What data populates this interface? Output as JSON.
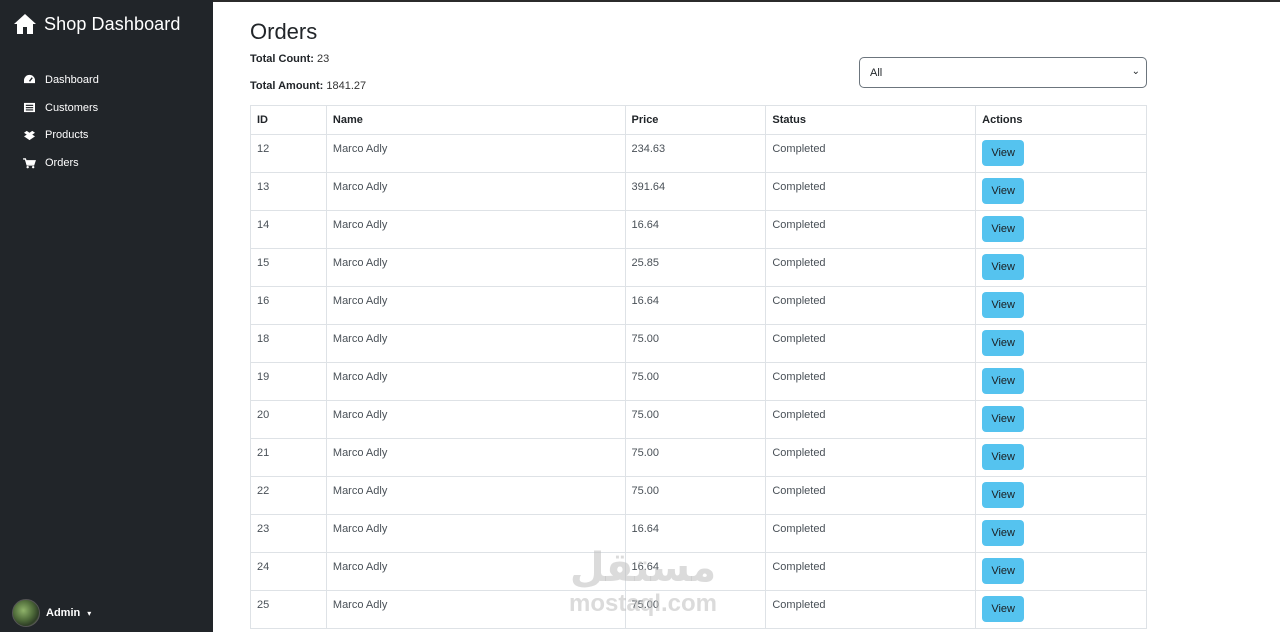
{
  "sidebar": {
    "brand": "Shop Dashboard",
    "items": [
      {
        "label": "Dashboard",
        "icon": "dashboard-icon"
      },
      {
        "label": "Customers",
        "icon": "list-icon"
      },
      {
        "label": "Products",
        "icon": "box-icon"
      },
      {
        "label": "Orders",
        "icon": "cart-icon"
      }
    ],
    "user": {
      "name": "Admin"
    }
  },
  "page": {
    "title": "Orders",
    "total_count_label": "Total Count:",
    "total_count": "23",
    "total_amount_label": "Total Amount:",
    "total_amount": "1841.27",
    "filter": {
      "selected": "All"
    }
  },
  "table": {
    "columns": [
      "ID",
      "Name",
      "Price",
      "Status",
      "Actions"
    ],
    "action_label": "View",
    "rows": [
      {
        "id": "12",
        "name": "Marco Adly",
        "price": "234.63",
        "status": "Completed"
      },
      {
        "id": "13",
        "name": "Marco Adly",
        "price": "391.64",
        "status": "Completed"
      },
      {
        "id": "14",
        "name": "Marco Adly",
        "price": "16.64",
        "status": "Completed"
      },
      {
        "id": "15",
        "name": "Marco Adly",
        "price": "25.85",
        "status": "Completed"
      },
      {
        "id": "16",
        "name": "Marco Adly",
        "price": "16.64",
        "status": "Completed"
      },
      {
        "id": "18",
        "name": "Marco Adly",
        "price": "75.00",
        "status": "Completed"
      },
      {
        "id": "19",
        "name": "Marco Adly",
        "price": "75.00",
        "status": "Completed"
      },
      {
        "id": "20",
        "name": "Marco Adly",
        "price": "75.00",
        "status": "Completed"
      },
      {
        "id": "21",
        "name": "Marco Adly",
        "price": "75.00",
        "status": "Completed"
      },
      {
        "id": "22",
        "name": "Marco Adly",
        "price": "75.00",
        "status": "Completed"
      },
      {
        "id": "23",
        "name": "Marco Adly",
        "price": "16.64",
        "status": "Completed"
      },
      {
        "id": "24",
        "name": "Marco Adly",
        "price": "16.64",
        "status": "Completed"
      },
      {
        "id": "25",
        "name": "Marco Adly",
        "price": "75.00",
        "status": "Completed"
      }
    ]
  },
  "watermark": {
    "arabic": "مستقل",
    "latin": "mostaql.com"
  },
  "colors": {
    "sidebar": "#212529",
    "button": "#55c3ef"
  }
}
